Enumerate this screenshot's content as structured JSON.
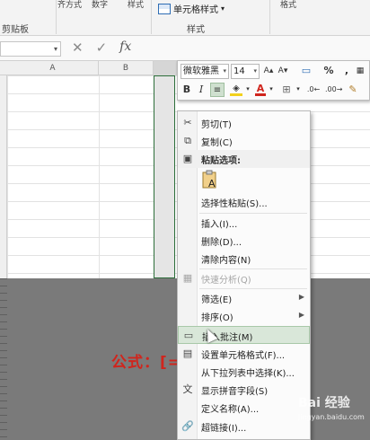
{
  "ribbon": {
    "clipboard_label": "剪贴板",
    "styles_label": "样式",
    "cell_styles_button": "单元格样式",
    "partial_top_labels": [
      "齐方式",
      "数字",
      "样式",
      "格式"
    ]
  },
  "formula_bar": {
    "name_box_value": "",
    "cancel_symbol": "✕",
    "confirm_symbol": "✓",
    "fx_symbol": "fx"
  },
  "sheet": {
    "columns": [
      "A",
      "B"
    ]
  },
  "mini_toolbar": {
    "font_name": "微软雅黑",
    "font_size": "14",
    "buttons": [
      "B",
      "I",
      "%",
      ","
    ]
  },
  "context_menu": {
    "items": [
      {
        "label": "剪切(T)",
        "icon": "scissors-icon",
        "glyph": "✂",
        "enabled": true
      },
      {
        "label": "复制(C)",
        "icon": "copy-icon",
        "glyph": "⧉",
        "enabled": true
      },
      {
        "label": "粘贴选项:",
        "icon": "paste-options-icon",
        "glyph": "📋",
        "enabled": true
      },
      {
        "label": "选择性粘贴(S)...",
        "icon": "",
        "glyph": "",
        "enabled": true
      },
      {
        "label": "插入(I)...",
        "icon": "",
        "glyph": "",
        "enabled": true
      },
      {
        "label": "删除(D)...",
        "icon": "",
        "glyph": "",
        "enabled": true
      },
      {
        "label": "清除内容(N)",
        "icon": "",
        "glyph": "",
        "enabled": true
      },
      {
        "label": "快速分析(Q)",
        "icon": "quick-analysis-icon",
        "glyph": "▦",
        "enabled": false
      },
      {
        "label": "筛选(E)",
        "icon": "",
        "glyph": "",
        "enabled": true
      },
      {
        "label": "排序(O)",
        "icon": "",
        "glyph": "",
        "enabled": true
      },
      {
        "label": "插入批注(M)",
        "icon": "insert-comment-icon",
        "glyph": "▭",
        "enabled": true
      },
      {
        "label": "设置单元格格式(F)...",
        "icon": "format-cells-icon",
        "glyph": "▤",
        "enabled": true
      },
      {
        "label": "从下拉列表中选择(K)...",
        "icon": "",
        "glyph": "",
        "enabled": true
      },
      {
        "label": "显示拼音字段(S)",
        "icon": "phonetic-icon",
        "glyph": "文",
        "enabled": true
      },
      {
        "label": "定义名称(A)...",
        "icon": "",
        "glyph": "",
        "enabled": true
      },
      {
        "label": "超链接(I)...",
        "icon": "hyperlink-icon",
        "glyph": "🔗",
        "enabled": true
      }
    ]
  },
  "overlay": {
    "formula_caption": "公式：[="
  },
  "watermark": {
    "brand": "Bai 经验",
    "url": "jingyan.baidu.com"
  },
  "colors": {
    "selection_border": "#2d6e3a",
    "caption_red": "#d0251d",
    "highlight_bg": "#d9e7d9"
  }
}
